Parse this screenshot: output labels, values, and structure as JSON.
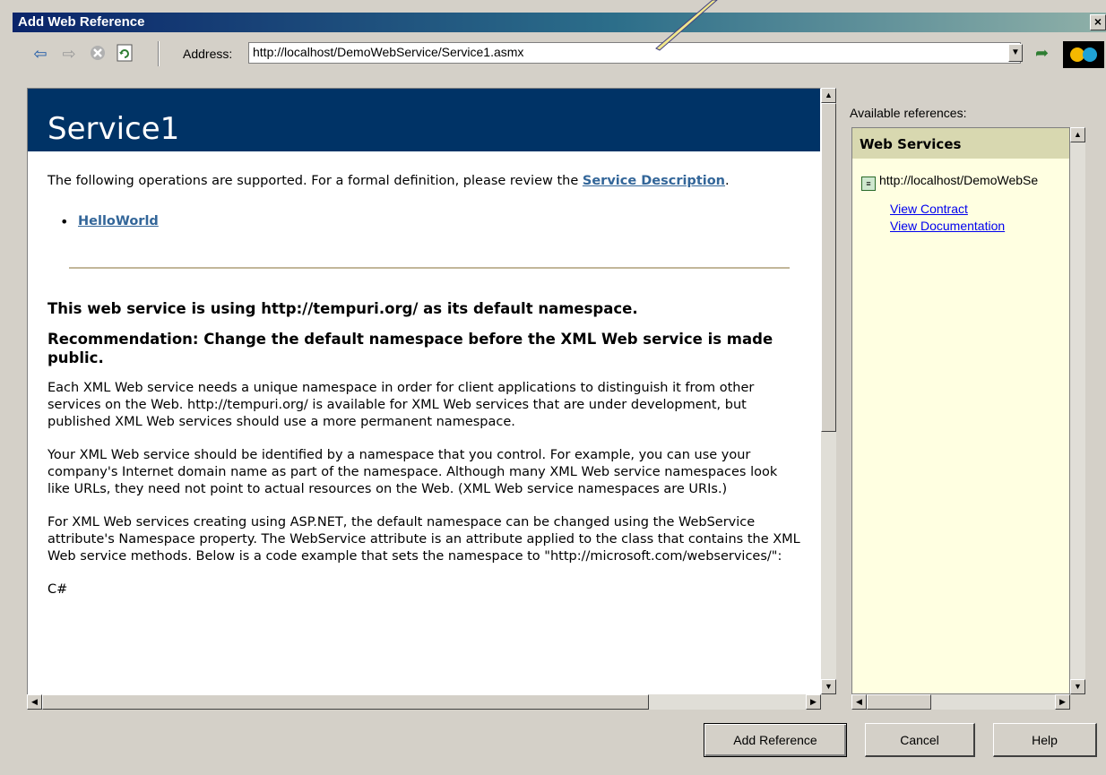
{
  "window": {
    "title": "Add Web Reference",
    "close_glyph": "×"
  },
  "toolbar": {
    "address_label": "Address:",
    "address_value": "http://localhost/DemoWebService/Service1.asmx"
  },
  "page": {
    "service_name": "Service1",
    "intro_text": "The following operations are supported. For a formal definition, please review the ",
    "service_description_link": "Service Description",
    "intro_end": ".",
    "operations": [
      "HelloWorld"
    ],
    "namespace_heading": "This web service is using http://tempuri.org/ as its default namespace.",
    "recommendation_heading": "Recommendation: Change the default namespace before the XML Web service is made public.",
    "paragraph1": "Each XML Web service needs a unique namespace in order for client applications to distinguish it from other services on the Web. http://tempuri.org/ is available for XML Web services that are under development, but published XML Web services should use a more permanent namespace.",
    "paragraph2": "Your XML Web service should be identified by a namespace that you control. For example, you can use your company's Internet domain name as part of the namespace. Although many XML Web service namespaces look like URLs, they need not point to actual resources on the Web. (XML Web service namespaces are URIs.)",
    "paragraph3": "For XML Web services creating using ASP.NET, the default namespace can be changed using the WebService attribute's Namespace property. The WebService attribute is an attribute applied to the class that contains the XML Web service methods. Below is a code example that sets the namespace to \"http://microsoft.com/webservices/\":",
    "code_lang": "C#"
  },
  "references": {
    "label": "Available references:",
    "group_title": "Web Services",
    "url": "http://localhost/DemoWebSe",
    "view_contract": "View Contract",
    "view_documentation": "View Documentation"
  },
  "buttons": {
    "add_reference": "Add Reference",
    "cancel": "Cancel",
    "help": "Help"
  },
  "colors": {
    "service_header_bg": "#003366",
    "link": "#336699",
    "panel_bg": "#ffffe1"
  }
}
